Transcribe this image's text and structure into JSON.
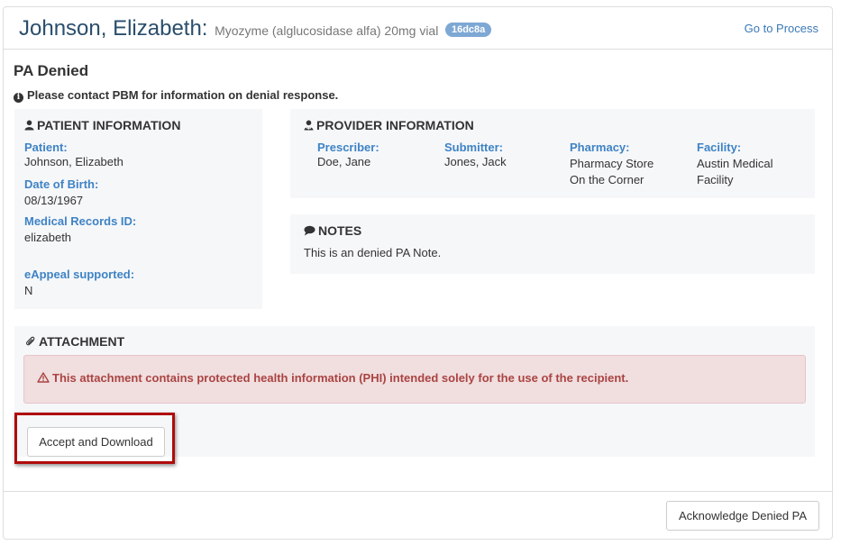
{
  "header": {
    "patient_name": "Johnson, Elizabeth:",
    "drug": "Myozyme (alglucosidase alfa) 20mg vial",
    "badge": "16dc8a",
    "goto_link": "Go to Process"
  },
  "status": {
    "title": "PA Denied",
    "message": "Please contact PBM for information on denial response."
  },
  "patient_info": {
    "heading": "PATIENT INFORMATION",
    "patient_label": "Patient:",
    "patient_value": "Johnson, Elizabeth",
    "dob_label": "Date of Birth:",
    "dob_value": "08/13/1967",
    "mrid_label": "Medical Records ID:",
    "mrid_value": "elizabeth",
    "eappeal_label": "eAppeal supported:",
    "eappeal_value": "N"
  },
  "provider_info": {
    "heading": "PROVIDER INFORMATION",
    "prescriber_label": "Prescriber:",
    "prescriber_value": "Doe, Jane",
    "submitter_label": "Submitter:",
    "submitter_value": "Jones, Jack",
    "pharmacy_label": "Pharmacy:",
    "pharmacy_value_1": "Pharmacy Store",
    "pharmacy_value_2": "On the Corner",
    "facility_label": "Facility:",
    "facility_value_1": "Austin Medical",
    "facility_value_2": "Facility"
  },
  "notes": {
    "heading": "NOTES",
    "text": "This is an denied PA Note."
  },
  "attachment": {
    "heading": "ATTACHMENT",
    "phi_warning": "This attachment contains protected health information (PHI) intended solely for the use of the recipient.",
    "accept_button": "Accept and Download"
  },
  "footer": {
    "acknowledge_button": "Acknowledge Denied PA"
  },
  "icons": {
    "user": "user-icon",
    "provider": "user-md-icon",
    "notes": "comment-icon",
    "attachment": "paperclip-icon",
    "warning": "warning-icon",
    "info": "info-circle-icon"
  },
  "colors": {
    "name_color": "#2a4e6c",
    "label_blue": "#3e83c5",
    "badge_bg": "#7ea8d4",
    "alert_bg": "#f1dedf",
    "alert_text": "#a94442",
    "highlight": "#b00b0b"
  }
}
